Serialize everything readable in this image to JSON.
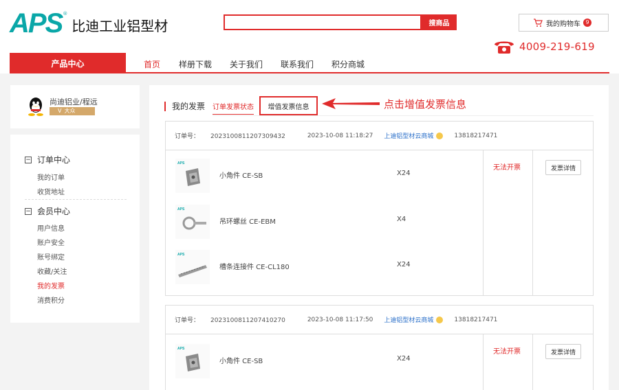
{
  "header": {
    "logo_mark": "APS",
    "logo_text": "比迪工业铝型材",
    "search": {
      "placeholder": "",
      "button_label": "搜商品"
    },
    "cart": {
      "label": "我的购物车",
      "count": "9"
    },
    "hotline": "4009-219-619"
  },
  "nav": {
    "product_center": "产品中心",
    "items": [
      "首页",
      "样册下载",
      "关于我们",
      "联系我们",
      "积分商城"
    ],
    "active_index": 0
  },
  "user": {
    "name": "尚迪铝业/程远",
    "level": "大众"
  },
  "sidebar": {
    "sections": [
      {
        "title": "订单中心",
        "links": [
          "我的订单",
          "收货地址"
        ]
      },
      {
        "title": "会员中心",
        "links": [
          "用户信息",
          "账户安全",
          "账号绑定",
          "收藏/关注",
          "我的发票",
          "消费积分"
        ]
      }
    ],
    "active_link": "我的发票"
  },
  "main": {
    "title": "我的发票",
    "tabs": [
      "订单发票状态",
      "增值发票信息"
    ],
    "annotation": "点击增值发票信息"
  },
  "orders": [
    {
      "order_label": "订单号：",
      "order_no": "2023100811207309432",
      "time": "2023-10-08 11:18:27",
      "shop": "上迪铝型材云商城",
      "phone": "13818217471",
      "items": [
        {
          "name": "小角件 CE-SB",
          "qty": "X24"
        },
        {
          "name": "吊环螺丝 CE-EBM",
          "qty": "X4"
        },
        {
          "name": "槽条连接件 CE-CL180",
          "qty": "X24"
        }
      ],
      "status": "无法开票",
      "action": "发票详情"
    },
    {
      "order_label": "订单号：",
      "order_no": "2023100811207410270",
      "time": "2023-10-08 11:17:50",
      "shop": "上迪铝型材云商城",
      "phone": "13818217471",
      "items": [
        {
          "name": "小角件 CE-SB",
          "qty": "X24"
        }
      ],
      "status": "无法开票",
      "action": "发票详情"
    }
  ],
  "colors": {
    "accent": "#e02b2b",
    "logo": "#0aa7a8",
    "link": "#2a6fc9"
  }
}
